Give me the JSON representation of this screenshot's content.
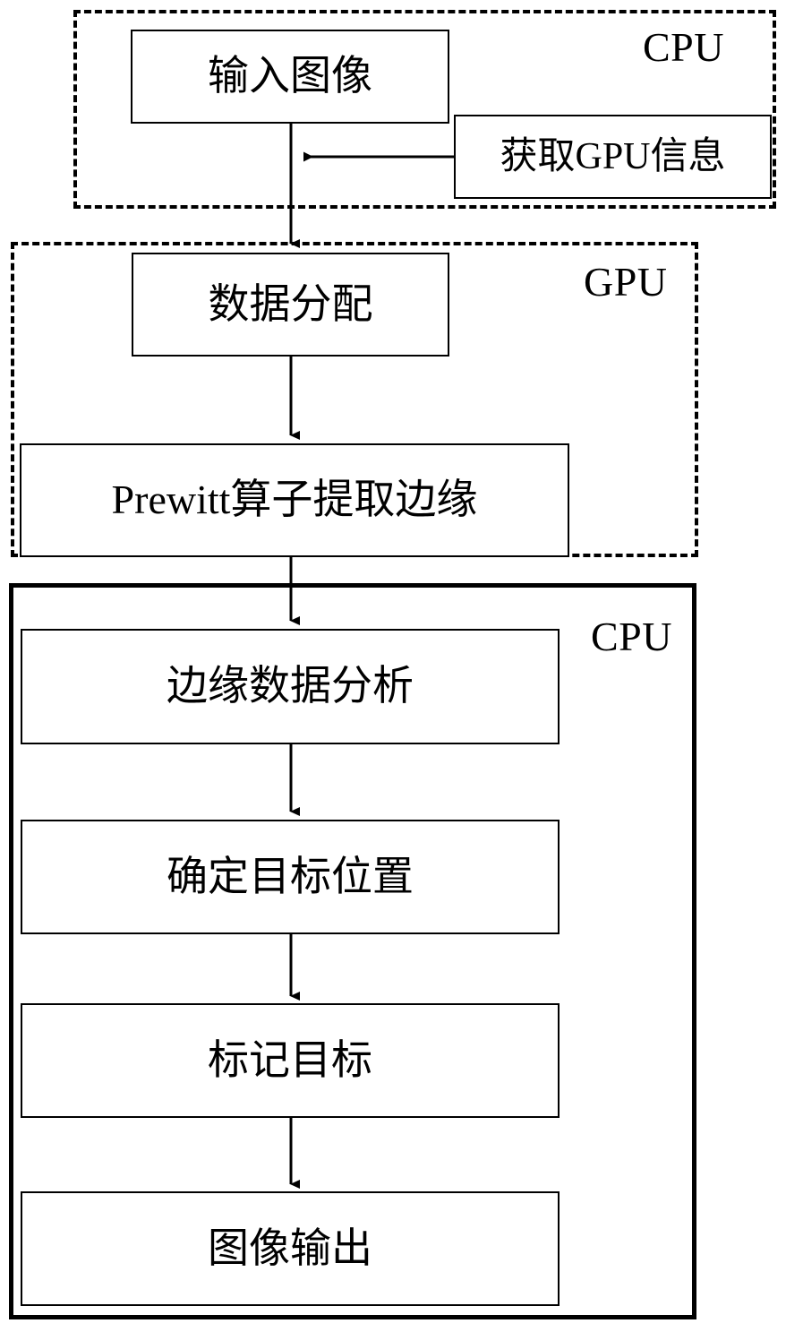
{
  "diagram": {
    "title": "CPU-GPU Prewitt edge detection flowchart",
    "colors": {
      "stroke": "#000000",
      "background": "#ffffff"
    },
    "groups": [
      {
        "id": "cpu-top",
        "caption": "CPU",
        "border_style": "dashed"
      },
      {
        "id": "gpu",
        "caption": "GPU",
        "border_style": "dashed"
      },
      {
        "id": "cpu-bottom",
        "caption": "CPU",
        "border_style": "solid"
      }
    ],
    "nodes": [
      {
        "id": "input-image",
        "label": "输入图像"
      },
      {
        "id": "get-gpu-info",
        "label": "获取GPU信息"
      },
      {
        "id": "data-allocation",
        "label": "数据分配"
      },
      {
        "id": "prewitt-edge",
        "label": "Prewitt算子提取边缘"
      },
      {
        "id": "edge-data-analysis",
        "label": "边缘数据分析"
      },
      {
        "id": "locate-target",
        "label": "确定目标位置"
      },
      {
        "id": "mark-target",
        "label": "标记目标"
      },
      {
        "id": "image-output",
        "label": "图像输出"
      }
    ],
    "edges": [
      {
        "id": "e1",
        "from": "get-gpu-info",
        "to": "input-image",
        "direction": "left"
      },
      {
        "id": "e2",
        "from": "input-image",
        "to": "data-allocation",
        "direction": "down"
      },
      {
        "id": "e3",
        "from": "data-allocation",
        "to": "prewitt-edge",
        "direction": "down"
      },
      {
        "id": "e4",
        "from": "prewitt-edge",
        "to": "edge-data-analysis",
        "direction": "down"
      },
      {
        "id": "e5",
        "from": "edge-data-analysis",
        "to": "locate-target",
        "direction": "down"
      },
      {
        "id": "e6",
        "from": "locate-target",
        "to": "mark-target",
        "direction": "down"
      },
      {
        "id": "e7",
        "from": "mark-target",
        "to": "image-output",
        "direction": "down"
      }
    ]
  }
}
